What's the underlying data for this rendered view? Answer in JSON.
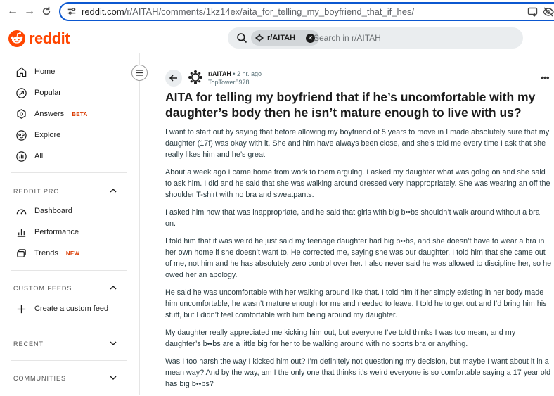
{
  "browser": {
    "url_domain": "reddit.com",
    "url_path": "/r/AITAH/comments/1kz14ex/aita_for_telling_my_boyfriend_that_if_hes/"
  },
  "header": {
    "logo_text": "reddit",
    "search_chip": "r/AITAH",
    "search_placeholder": "Search in r/AITAH"
  },
  "sidebar": {
    "nav": [
      {
        "label": "Home",
        "icon": "home-icon"
      },
      {
        "label": "Popular",
        "icon": "popular-icon"
      },
      {
        "label": "Answers",
        "icon": "answers-icon",
        "badge": "BETA"
      },
      {
        "label": "Explore",
        "icon": "explore-icon"
      },
      {
        "label": "All",
        "icon": "all-icon"
      }
    ],
    "reddit_pro": {
      "title": "REDDIT PRO",
      "items": [
        {
          "label": "Dashboard",
          "icon": "dashboard-icon"
        },
        {
          "label": "Performance",
          "icon": "performance-icon"
        },
        {
          "label": "Trends",
          "icon": "trends-icon",
          "badge": "NEW"
        }
      ]
    },
    "custom_feeds": {
      "title": "CUSTOM FEEDS",
      "create_label": "Create a custom feed"
    },
    "recent": {
      "title": "RECENT"
    },
    "communities": {
      "title": "COMMUNITIES"
    }
  },
  "post": {
    "subreddit": "r/AITAH",
    "time": "2 hr. ago",
    "author": "TopTower8978",
    "title": "AITA for telling my boyfriend that if he’s uncomfortable with my daughter’s body then he isn’t mature enough to live with us?",
    "paragraphs": [
      "I want to start out by saying that before allowing my boyfriend of 5 years to move in I made absolutely sure that my daughter (17f) was okay with it. She and him have always been close, and she’s told me every time I ask that she really likes him and he’s great.",
      "About a week ago I came home from work to them arguing. I asked my daughter what was going on and she said to ask him. I did and he said that she was walking around dressed very inappropriately. She was wearing an off the shoulder T-shirt with no bra and sweatpants.",
      "I asked him how that was inappropriate, and he said that girls with big b••bs shouldn’t walk around without a bra on.",
      "I told him that it was weird he just said my teenage daughter had big b••bs, and she doesn’t have to wear a bra in her own home if she doesn’t want to. He corrected me, saying she was our daughter. I told him that she came out of me, not him and he has absolutely zero control over her. I also never said he was allowed to discipline her, so he owed her an apology.",
      "He said he was uncomfortable with her walking around like that. I told him if her simply existing in her body made him uncomfortable, he wasn’t mature enough for me and needed to leave. I told he to get out and I’d bring him his stuff, but I didn’t feel comfortable with him being around my daughter.",
      "My daughter really appreciated me kicking him out, but everyone I’ve told thinks I was too mean, and my daughter’s b••bs are a little big for her to be walking around with no sports bra or anything.",
      "Was I too harsh the way I kicked him out? I’m definitely not questioning my decision, but maybe I want about it in a mean way? And by the way, am I the only one that thinks it’s weird everyone is so comfortable saying a 17 year old has big b••bs?"
    ]
  },
  "colors": {
    "brand": "#ff4500",
    "accent_blue": "#0b57d0",
    "badge": "#d93a00"
  }
}
